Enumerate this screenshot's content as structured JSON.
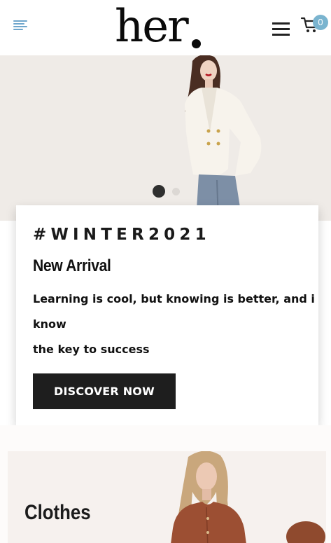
{
  "header": {
    "logo_text": "her",
    "cart_count": "0",
    "icons": {
      "left": "menu-lines-icon",
      "menu": "hamburger-icon",
      "cart": "shopping-cart-icon"
    }
  },
  "hero": {
    "background": "#efebe7",
    "slides": {
      "count": 2,
      "active": 1
    }
  },
  "promo": {
    "tag": "#WINTER2021",
    "title": "New Arrival",
    "description_lines": [
      "Learning is cool, but knowing is better, and i",
      "know",
      "the key to success"
    ],
    "button_label": "DISCOVER NOW"
  },
  "categories": [
    {
      "label": "Clothes"
    }
  ],
  "colors": {
    "accent": "#7ab4cf",
    "button": "#1e1e1e",
    "text": "#111111"
  }
}
